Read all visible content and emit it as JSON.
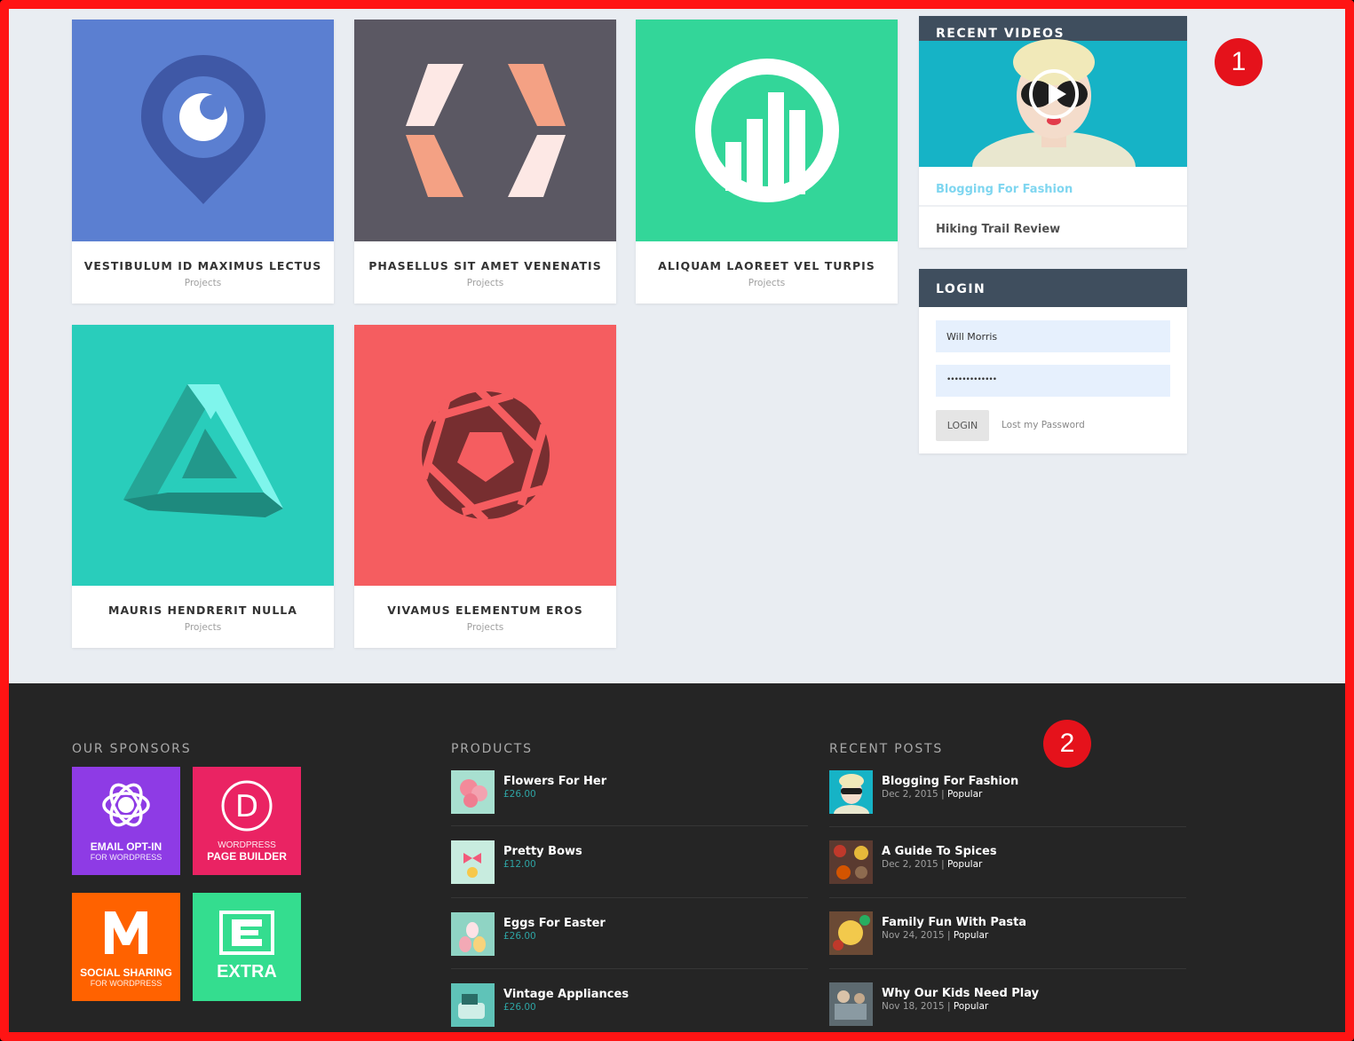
{
  "portfolio": {
    "cards": [
      {
        "title": "VESTIBULUM ID MAXIMUS LECTUS",
        "category": "Projects",
        "color": "#5b7fd1",
        "icon": "location-pin-icon"
      },
      {
        "title": "PHASELLUS SIT AMET VENENATIS",
        "category": "Projects",
        "color": "#5b5863",
        "icon": "code-brackets-icon"
      },
      {
        "title": "ALIQUAM LAOREET VEL TURPIS",
        "category": "Projects",
        "color": "#33d699",
        "icon": "circle-bars-icon"
      },
      {
        "title": "MAURIS HENDRERIT NULLA",
        "category": "Projects",
        "color": "#29cdbb",
        "icon": "penrose-triangle-icon"
      },
      {
        "title": "VIVAMUS ELEMENTUM EROS",
        "category": "Projects",
        "color": "#f55d60",
        "icon": "camera-aperture-icon"
      }
    ]
  },
  "sidebar": {
    "recent_videos": {
      "title": "RECENT VIDEOS",
      "items": [
        "Blogging For Fashion",
        "Hiking Trail Review"
      ]
    },
    "login": {
      "title": "LOGIN",
      "username": "Will Morris",
      "password": "•••••••••••••",
      "button": "LOGIN",
      "lost_password": "Lost my Password"
    }
  },
  "badges": [
    "1",
    "2"
  ],
  "footer": {
    "sponsors": {
      "title": "OUR SPONSORS",
      "items": [
        {
          "name": "EMAIL OPT-IN",
          "sub": "FOR WORDPRESS",
          "color": "#8e3be5",
          "icon": "bloom-icon"
        },
        {
          "name": "PAGE BUILDER",
          "sub": "WORDPRESS",
          "color": "#ea2363",
          "icon": "divi-icon"
        },
        {
          "name": "SOCIAL SHARING",
          "sub": "FOR WORDPRESS",
          "color": "#ff6200",
          "icon": "monarch-icon"
        },
        {
          "name": "EXTRA",
          "sub": "",
          "color": "#34dd8f",
          "icon": "extra-icon"
        }
      ]
    },
    "products": {
      "title": "PRODUCTS",
      "items": [
        {
          "name": "Flowers For Her",
          "price": "£26.00"
        },
        {
          "name": "Pretty Bows",
          "price": "£12.00"
        },
        {
          "name": "Eggs For Easter",
          "price": "£26.00"
        },
        {
          "name": "Vintage Appliances",
          "price": "£26.00"
        }
      ]
    },
    "recent_posts": {
      "title": "RECENT POSTS",
      "items": [
        {
          "title": "Blogging For Fashion",
          "date": "Dec 2, 2015",
          "category": "Popular"
        },
        {
          "title": "A Guide To Spices",
          "date": "Dec 2, 2015",
          "category": "Popular"
        },
        {
          "title": "Family Fun With Pasta",
          "date": "Nov 24, 2015",
          "category": "Popular"
        },
        {
          "title": "Why Our Kids Need Play",
          "date": "Nov 18, 2015",
          "category": "Popular"
        }
      ],
      "separator": "|"
    }
  },
  "colors": {
    "link_blue": "#7fd6f0",
    "price_teal": "#2ea3a3",
    "widget_header": "#3f4e5e",
    "footer_bg": "#252525",
    "badge_red": "#e5121b"
  }
}
